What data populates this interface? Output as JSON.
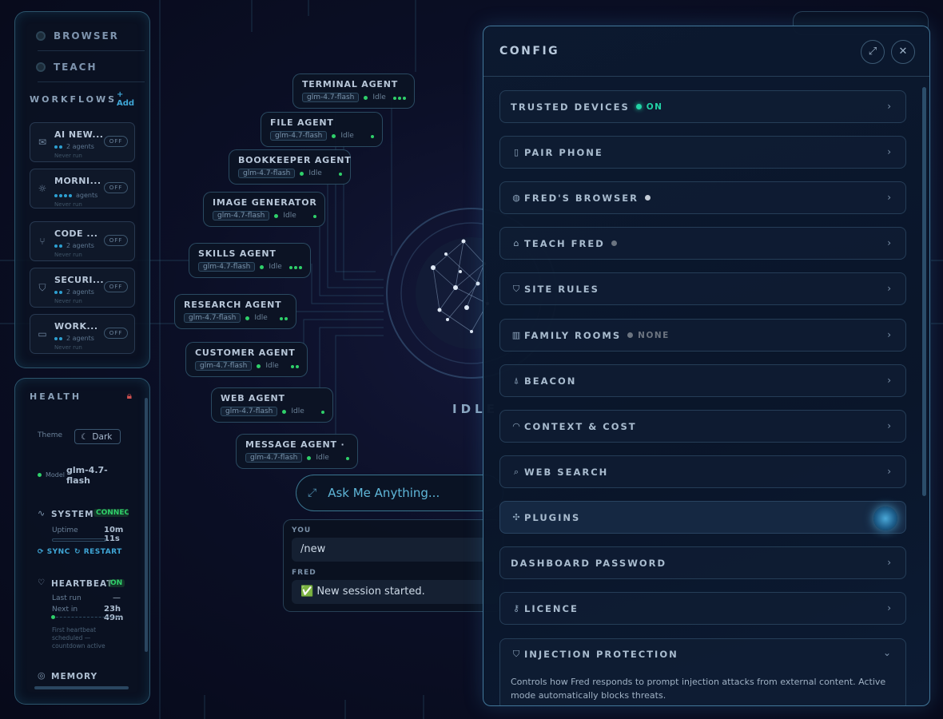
{
  "modes": [
    "BROWSER",
    "TEACH"
  ],
  "workflows": {
    "title": "WORKFLOWS",
    "add_label": "+ Add",
    "items": [
      {
        "name": "AI NEW...",
        "agents": "2 agents",
        "last": "Never run",
        "toggle": "OFF",
        "icon": "mail-icon"
      },
      {
        "name": "MORNI...",
        "agents": "agents",
        "last": "Never run",
        "toggle": "OFF",
        "icon": "sun-icon"
      },
      {
        "name": "CODE ...",
        "agents": "2 agents",
        "last": "Never run",
        "toggle": "OFF",
        "icon": "git-branch-icon"
      },
      {
        "name": "SECURI...",
        "agents": "2 agents",
        "last": "Never run",
        "toggle": "OFF",
        "icon": "shield-icon"
      },
      {
        "name": "WORK...",
        "agents": "2 agents",
        "last": "Never run",
        "toggle": "OFF",
        "icon": "inbox-icon"
      }
    ]
  },
  "health": {
    "title": "HEALTH",
    "theme_label": "Theme",
    "theme_value": "Dark",
    "model_label": "Model",
    "model_value": "glm-4.7-flash",
    "system_label": "SYSTEM",
    "system_status": "CONNEC",
    "uptime_label": "Uptime",
    "uptime_value": "10m 11s",
    "sync_label": "SYNC",
    "restart_label": "RESTART",
    "heartbeat_label": "HEARTBEAT",
    "heartbeat_status": "ON",
    "last_run_label": "Last run",
    "last_run_value": "—",
    "next_in_label": "Next in",
    "next_in_value": "23h 49m",
    "heartbeat_note": "First heartbeat scheduled — countdown active",
    "memory_label": "MEMORY"
  },
  "agents": [
    {
      "name": "TERMINAL AGENT",
      "model": "glm-4.7-flash",
      "status": "Idle",
      "dots": 3
    },
    {
      "name": "FILE AGENT",
      "model": "glm-4.7-flash",
      "status": "Idle",
      "dots": 1
    },
    {
      "name": "BOOKKEEPER AGENT",
      "model": "glm-4.7-flash",
      "status": "Idle",
      "dots": 1
    },
    {
      "name": "IMAGE GENERATOR",
      "model": "glm-4.7-flash",
      "status": "Idle",
      "dots": 1
    },
    {
      "name": "SKILLS AGENT",
      "model": "glm-4.7-flash",
      "status": "Idle",
      "dots": 3
    },
    {
      "name": "RESEARCH AGENT",
      "model": "glm-4.7-flash",
      "status": "Idle",
      "dots": 2
    },
    {
      "name": "CUSTOMER AGENT",
      "model": "glm-4.7-flash",
      "status": "Idle",
      "dots": 2
    },
    {
      "name": "WEB AGENT",
      "model": "glm-4.7-flash",
      "status": "Idle",
      "dots": 1
    },
    {
      "name": "MESSAGE AGENT · W...",
      "model": "glm-4.7-flash",
      "status": "Idle",
      "dots": 1
    }
  ],
  "center": {
    "status": "IDLE"
  },
  "chat": {
    "placeholder": "Ask Me Anything...",
    "you_label": "YOU",
    "you_message": "/new",
    "fred_label": "FRED",
    "fred_message": "✅ New session started."
  },
  "config": {
    "title": "CONFIG",
    "rows": [
      {
        "label": "TRUSTED DEVICES",
        "status": "ON",
        "status_color": "#22d3a6",
        "icon": "none"
      },
      {
        "label": "PAIR PHONE",
        "status": "",
        "icon": "phone-icon"
      },
      {
        "label": "FRED'S BROWSER",
        "status": "",
        "status_color": "#c4ccd6",
        "icon": "globe-icon"
      },
      {
        "label": "TEACH FRED",
        "status": "",
        "status_color": "#6b7480",
        "icon": "graduation-cap-icon"
      },
      {
        "label": "SITE RULES",
        "status": "",
        "icon": "shield-check-icon"
      },
      {
        "label": "FAMILY ROOMS",
        "status": "NONE",
        "status_color": "#6b7480",
        "icon": "building-icon"
      },
      {
        "label": "BEACON",
        "status": "",
        "icon": "beacon-icon"
      },
      {
        "label": "CONTEXT & COST",
        "status": "",
        "icon": "gauge-icon"
      },
      {
        "label": "WEB SEARCH",
        "status": "",
        "icon": "search-icon"
      },
      {
        "label": "PLUGINS",
        "status": "",
        "icon": "puzzle-icon"
      },
      {
        "label": "DASHBOARD PASSWORD",
        "status": "",
        "icon": "none"
      },
      {
        "label": "LICENCE",
        "status": "",
        "icon": "key-icon"
      },
      {
        "label": "INJECTION PROTECTION",
        "status": "",
        "icon": "shield-icon"
      }
    ],
    "injection_description": "Controls how Fred responds to prompt injection attacks from external content. Active mode automatically blocks threats.",
    "accent_color": "#22d3a6"
  }
}
